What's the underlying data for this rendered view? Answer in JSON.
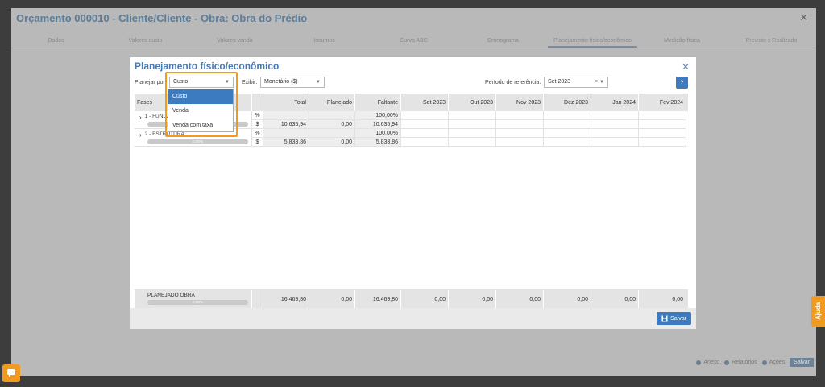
{
  "background": {
    "title": "Orçamento 000010 - Cliente/Cliente - Obra: Obra do Prédio",
    "tabs": [
      "Dados",
      "Valores custo",
      "Valores venda",
      "Insumos",
      "Curva ABC",
      "Cronograma",
      "Planejamento físico/econômico",
      "Medição física",
      "Previsto x Realizado"
    ],
    "footer": {
      "anexo": "Anexo",
      "relatorios": "Relatórios",
      "acoes": "Ações",
      "salvar": "Salvar"
    }
  },
  "help_label": "Ajuda",
  "modal": {
    "title": "Planejamento físico/econômico",
    "planejar_label": "Planejar por:",
    "planejar_value": "Custo",
    "exibir_label": "Exibir:",
    "exibir_value": "Monetário ($)",
    "periodo_label": "Período de referência:",
    "periodo_value": "Set 2023",
    "save_label": "Salvar"
  },
  "dropdown_options": [
    "Custo",
    "Venda",
    "Venda com taxa"
  ],
  "table": {
    "headers": {
      "fases": "Fases",
      "total": "Total",
      "planejado": "Planejado",
      "faltante": "Faltante",
      "months": [
        "Set 2023",
        "Out 2023",
        "Nov 2023",
        "Dez 2023",
        "Jan 2024",
        "Fev 2024"
      ]
    },
    "rows": [
      {
        "phase": "1 - FUNDAÇÃO",
        "progress": "0,00%",
        "pct": {
          "unit": "%",
          "total": "",
          "planejado": "",
          "faltante": "100,00%"
        },
        "money": {
          "unit": "$",
          "total": "10.635,94",
          "planejado": "0,00",
          "faltante": "10.635,94"
        }
      },
      {
        "phase": "2 - ESTRUTURA",
        "progress": "0,00%",
        "pct": {
          "unit": "%",
          "total": "",
          "planejado": "",
          "faltante": "100,00%"
        },
        "money": {
          "unit": "$",
          "total": "5.833,86",
          "planejado": "0,00",
          "faltante": "5.833,86"
        }
      }
    ],
    "footer": {
      "label": "PLANEJADO OBRA",
      "progress": "0,00%",
      "total": "16.469,80",
      "planejado": "0,00",
      "faltante": "16.469,80",
      "months": [
        "0,00",
        "0,00",
        "0,00",
        "0,00",
        "0,00",
        "0,00"
      ]
    }
  }
}
